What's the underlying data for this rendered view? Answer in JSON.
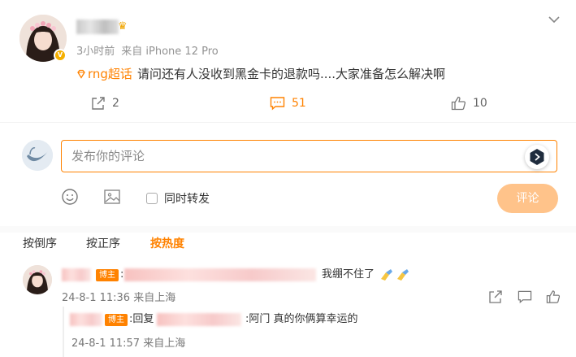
{
  "post": {
    "meta_time": "3小时前",
    "meta_source": "来自 iPhone 12 Pro",
    "topic": "rng超话",
    "text": "请问还有人没收到黑金卡的退款吗....大家准备怎么解决啊",
    "share_count": "2",
    "comment_count": "51",
    "like_count": "10"
  },
  "composer": {
    "placeholder": "发布你的评论",
    "repost_label": "同时转发",
    "submit_label": "评论"
  },
  "sort": {
    "tabs": [
      "按倒序",
      "按正序",
      "按热度"
    ],
    "active_index": 2
  },
  "comments": [
    {
      "badge": "博主",
      "text_prefix": ":",
      "text_suffix": "我绷不住了",
      "time": "24-8-1 11:36",
      "location": "来自上海",
      "reply": {
        "badge": "博主",
        "text_prefix": ":回复",
        "text_suffix": ":阿门 真的你俩算幸运的",
        "time": "24-8-1 11:57",
        "location": "来自上海"
      }
    }
  ],
  "colors": {
    "accent": "#ff8200",
    "submit_disabled": "#ffc38a",
    "meta_gray": "#939393"
  }
}
